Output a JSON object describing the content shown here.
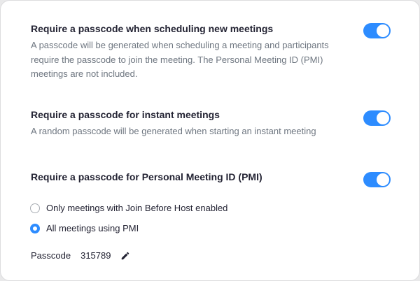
{
  "settings": [
    {
      "title": "Require a passcode when scheduling new meetings",
      "description": "A passcode will be generated when scheduling a meeting and participants require the passcode to join the meeting. The Personal Meeting ID (PMI) meetings are not included.",
      "enabled": true
    },
    {
      "title": "Require a passcode for instant meetings",
      "description": "A random passcode will be generated when starting an instant meeting",
      "enabled": true
    },
    {
      "title": "Require a passcode for Personal Meeting ID (PMI)",
      "description": "",
      "enabled": true
    }
  ],
  "pmi_options": [
    {
      "label": "Only meetings with Join Before Host enabled",
      "selected": false
    },
    {
      "label": "All meetings using PMI",
      "selected": true
    }
  ],
  "passcode": {
    "label": "Passcode",
    "value": "315789",
    "edit_icon": "pencil-icon"
  },
  "colors": {
    "accent": "#2d8cff",
    "title_text": "#232333",
    "description_text": "#6e7680"
  }
}
